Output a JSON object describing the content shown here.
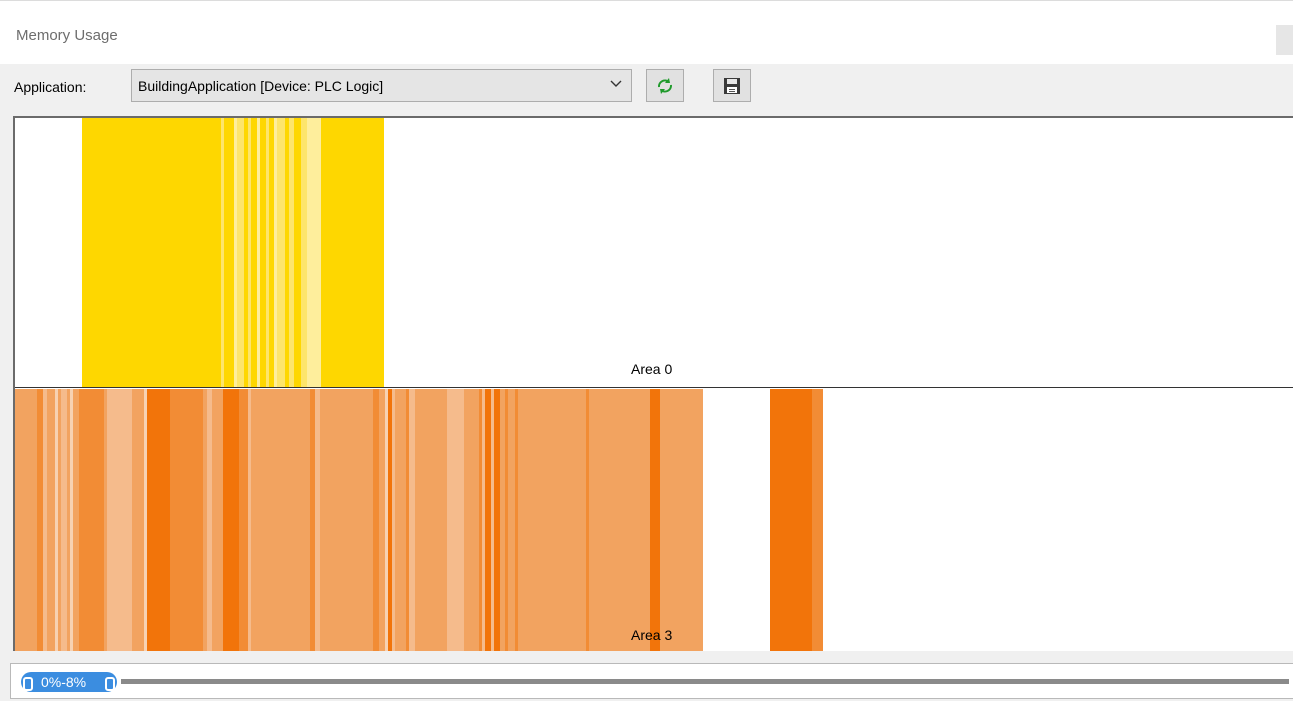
{
  "window": {
    "title": "Memory Usage"
  },
  "toolbar": {
    "application_label": "Application:",
    "application_value": "BuildingApplication [Device: PLC Logic]",
    "refresh_icon": "refresh-icon",
    "save_icon": "save-icon"
  },
  "colors": {
    "area0_base": "#fed700",
    "area0_light": "#fde56b",
    "area0_pale": "#feee9c",
    "area3_base": "#f2a360",
    "area3_dark": "#f2740a",
    "area3_mid": "#f28c35",
    "area3_light": "#f5bb8c",
    "area3_pale": "#f7d2b3",
    "scroll_accent": "#3b8de0"
  },
  "areas": [
    {
      "label": "Area 0",
      "segments": [
        {
          "start": 67,
          "end": 206,
          "shade": "base"
        },
        {
          "start": 206,
          "end": 209,
          "shade": "light"
        },
        {
          "start": 209,
          "end": 219,
          "shade": "base"
        },
        {
          "start": 219,
          "end": 222,
          "shade": "pale"
        },
        {
          "start": 222,
          "end": 229,
          "shade": "light"
        },
        {
          "start": 229,
          "end": 233,
          "shade": "base"
        },
        {
          "start": 233,
          "end": 236,
          "shade": "light"
        },
        {
          "start": 236,
          "end": 242,
          "shade": "base"
        },
        {
          "start": 242,
          "end": 245,
          "shade": "pale"
        },
        {
          "start": 245,
          "end": 251,
          "shade": "base"
        },
        {
          "start": 251,
          "end": 254,
          "shade": "light"
        },
        {
          "start": 254,
          "end": 259,
          "shade": "base"
        },
        {
          "start": 259,
          "end": 262,
          "shade": "pale"
        },
        {
          "start": 262,
          "end": 270,
          "shade": "light"
        },
        {
          "start": 270,
          "end": 274,
          "shade": "base"
        },
        {
          "start": 274,
          "end": 279,
          "shade": "light"
        },
        {
          "start": 279,
          "end": 286,
          "shade": "base"
        },
        {
          "start": 286,
          "end": 292,
          "shade": "light"
        },
        {
          "start": 292,
          "end": 306,
          "shade": "pale"
        },
        {
          "start": 306,
          "end": 369,
          "shade": "base"
        }
      ]
    },
    {
      "label": "Area 3",
      "segments": [
        {
          "start": 0,
          "end": 22,
          "shade": "base"
        },
        {
          "start": 22,
          "end": 28,
          "shade": "mid"
        },
        {
          "start": 28,
          "end": 32,
          "shade": "light"
        },
        {
          "start": 32,
          "end": 40,
          "shade": "base"
        },
        {
          "start": 40,
          "end": 43,
          "shade": "pale"
        },
        {
          "start": 43,
          "end": 46,
          "shade": "base"
        },
        {
          "start": 46,
          "end": 52,
          "shade": "light"
        },
        {
          "start": 52,
          "end": 55,
          "shade": "base"
        },
        {
          "start": 55,
          "end": 58,
          "shade": "pale"
        },
        {
          "start": 58,
          "end": 64,
          "shade": "base"
        },
        {
          "start": 64,
          "end": 89,
          "shade": "mid"
        },
        {
          "start": 89,
          "end": 92,
          "shade": "base"
        },
        {
          "start": 92,
          "end": 117,
          "shade": "light"
        },
        {
          "start": 117,
          "end": 129,
          "shade": "base"
        },
        {
          "start": 129,
          "end": 132,
          "shade": "pale"
        },
        {
          "start": 132,
          "end": 155,
          "shade": "dark"
        },
        {
          "start": 155,
          "end": 188,
          "shade": "mid"
        },
        {
          "start": 188,
          "end": 192,
          "shade": "base"
        },
        {
          "start": 192,
          "end": 197,
          "shade": "light"
        },
        {
          "start": 197,
          "end": 208,
          "shade": "base"
        },
        {
          "start": 208,
          "end": 224,
          "shade": "dark"
        },
        {
          "start": 224,
          "end": 233,
          "shade": "mid"
        },
        {
          "start": 233,
          "end": 236,
          "shade": "light"
        },
        {
          "start": 236,
          "end": 243,
          "shade": "base"
        },
        {
          "start": 243,
          "end": 295,
          "shade": "base"
        },
        {
          "start": 295,
          "end": 300,
          "shade": "mid"
        },
        {
          "start": 300,
          "end": 305,
          "shade": "light"
        },
        {
          "start": 305,
          "end": 358,
          "shade": "base"
        },
        {
          "start": 358,
          "end": 364,
          "shade": "mid"
        },
        {
          "start": 364,
          "end": 370,
          "shade": "base"
        },
        {
          "start": 370,
          "end": 373,
          "shade": "pale"
        },
        {
          "start": 373,
          "end": 377,
          "shade": "dark"
        },
        {
          "start": 377,
          "end": 380,
          "shade": "light"
        },
        {
          "start": 380,
          "end": 391,
          "shade": "base"
        },
        {
          "start": 391,
          "end": 394,
          "shade": "mid"
        },
        {
          "start": 394,
          "end": 400,
          "shade": "light"
        },
        {
          "start": 400,
          "end": 432,
          "shade": "base"
        },
        {
          "start": 432,
          "end": 449,
          "shade": "light"
        },
        {
          "start": 449,
          "end": 464,
          "shade": "base"
        },
        {
          "start": 464,
          "end": 467,
          "shade": "mid"
        },
        {
          "start": 467,
          "end": 470,
          "shade": "light"
        },
        {
          "start": 470,
          "end": 476,
          "shade": "dark"
        },
        {
          "start": 476,
          "end": 479,
          "shade": "light"
        },
        {
          "start": 479,
          "end": 485,
          "shade": "dark"
        },
        {
          "start": 485,
          "end": 490,
          "shade": "base"
        },
        {
          "start": 490,
          "end": 493,
          "shade": "mid"
        },
        {
          "start": 493,
          "end": 500,
          "shade": "base"
        },
        {
          "start": 500,
          "end": 503,
          "shade": "mid"
        },
        {
          "start": 503,
          "end": 571,
          "shade": "base"
        },
        {
          "start": 571,
          "end": 574,
          "shade": "mid"
        },
        {
          "start": 574,
          "end": 635,
          "shade": "base"
        },
        {
          "start": 635,
          "end": 645,
          "shade": "dark"
        },
        {
          "start": 645,
          "end": 688,
          "shade": "base"
        },
        {
          "start": 755,
          "end": 797,
          "shade": "dark"
        },
        {
          "start": 797,
          "end": 808,
          "shade": "mid"
        }
      ]
    }
  ],
  "scroll": {
    "range_label": "0%-8%"
  }
}
